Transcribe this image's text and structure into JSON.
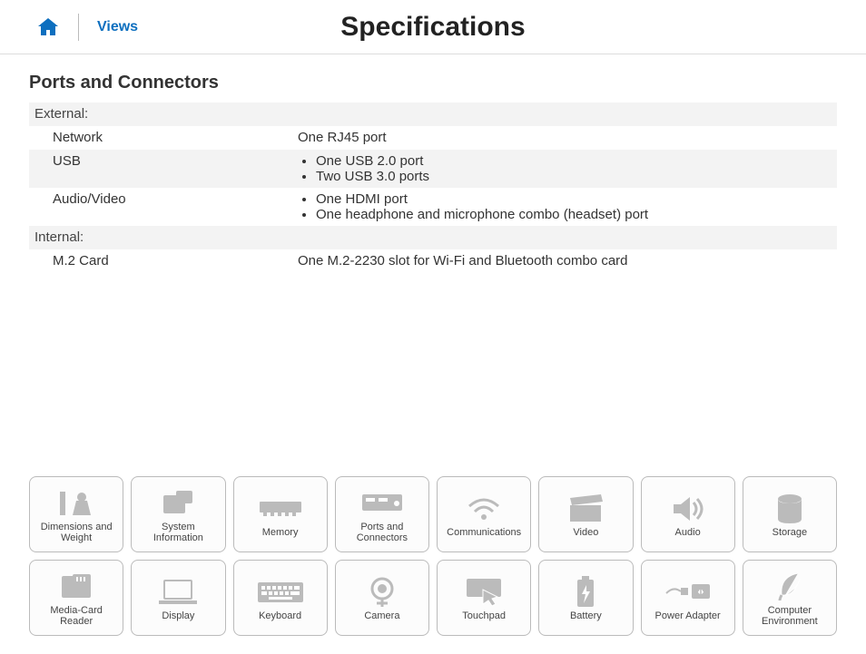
{
  "header": {
    "views_label": "Views",
    "title": "Specifications"
  },
  "section": {
    "title": "Ports and Connectors",
    "groups": [
      {
        "label": "External:",
        "rows": [
          {
            "label": "Network",
            "value": "One RJ45 port"
          },
          {
            "label": "USB",
            "bullets": [
              "One USB 2.0 port",
              "Two USB 3.0 ports"
            ]
          },
          {
            "label": "Audio/Video",
            "bullets": [
              "One HDMI port",
              "One headphone and microphone combo (headset) port"
            ]
          }
        ]
      },
      {
        "label": "Internal:",
        "rows": [
          {
            "label": "M.2 Card",
            "value": "One M.2-2230 slot for Wi-Fi and Bluetooth combo card"
          }
        ]
      }
    ]
  },
  "nav": [
    "Dimensions and Weight",
    "System Information",
    "Memory",
    "Ports and Connectors",
    "Communications",
    "Video",
    "Audio",
    "Storage",
    "Media-Card Reader",
    "Display",
    "Keyboard",
    "Camera",
    "Touchpad",
    "Battery",
    "Power Adapter",
    "Computer Environment"
  ]
}
